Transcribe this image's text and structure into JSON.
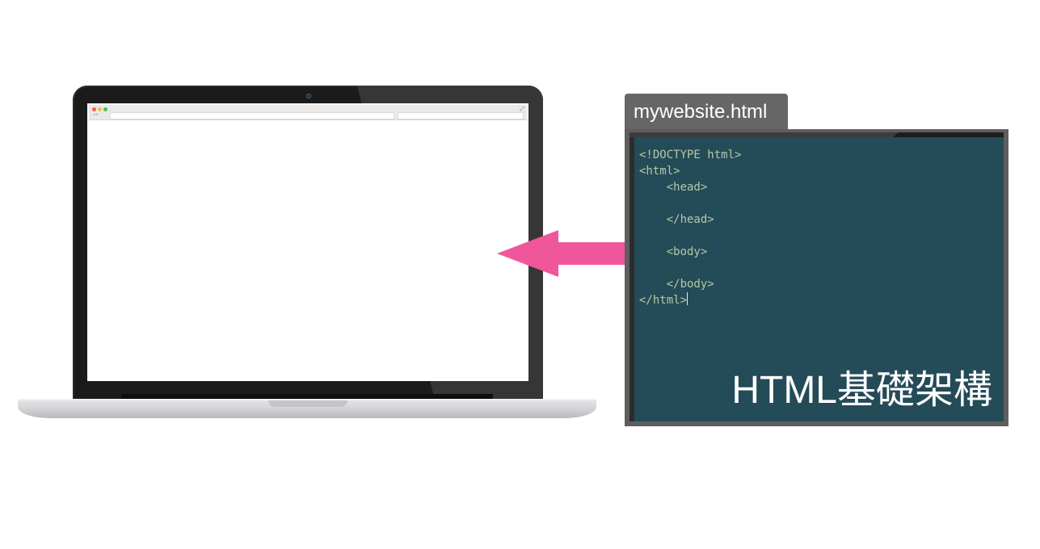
{
  "editor": {
    "file_name": "mywebsite.html",
    "code_lines": [
      "<!DOCTYPE html>",
      "<html>",
      "    <head>",
      "",
      "    </head>",
      "",
      "    <body>",
      "",
      "    </body>",
      "</html>"
    ],
    "caption": "HTML基礎架構"
  },
  "colors": {
    "arrow": "#f0579a",
    "editor_background": "#244b58",
    "code_text": "#b5c9a6",
    "tab_background": "#666666"
  },
  "icons": {
    "arrow": "arrow-left-icon",
    "laptop": "laptop-icon"
  }
}
